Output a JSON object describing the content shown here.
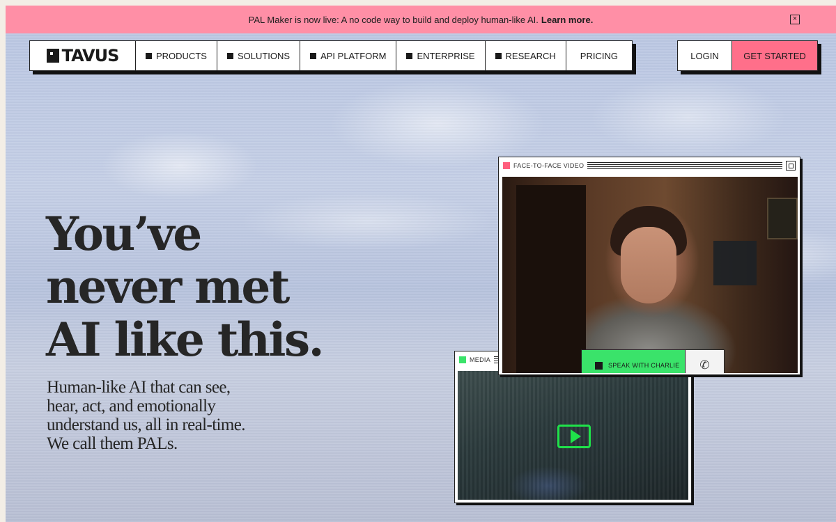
{
  "announcement": {
    "text": "PAL Maker is now live: A no code way to build and deploy human-like AI.",
    "link": "Learn more.",
    "close_icon": "close-icon"
  },
  "brand": {
    "name": "TAVUS"
  },
  "nav": {
    "items": [
      {
        "label": "PRODUCTS"
      },
      {
        "label": "SOLUTIONS"
      },
      {
        "label": "API PLATFORM"
      },
      {
        "label": "ENTERPRISE"
      },
      {
        "label": "RESEARCH"
      },
      {
        "label": "PRICING"
      }
    ]
  },
  "auth": {
    "login": "LOGIN",
    "get_started": "GET STARTED"
  },
  "hero": {
    "title_lines": [
      "You’ve",
      "never met",
      "AI like this."
    ],
    "subtitle": "Human-like AI that can see, hear, act, and emotionally understand us, all in real-time. We call them PALs."
  },
  "video_window": {
    "title": "FACE-TO-FACE VIDEO",
    "indicator_color": "#ff5f7e",
    "speak_button": "SPEAK WITH CHARLIE",
    "phone_icon": "phone-icon"
  },
  "media_window": {
    "title": "MEDIA",
    "indicator_color": "#3ae36a",
    "play_icon": "play-icon"
  },
  "colors": {
    "announcement_bg": "#ff8fa6",
    "cta_bg": "#ff6f8a",
    "accent_green": "#3ae36a"
  }
}
